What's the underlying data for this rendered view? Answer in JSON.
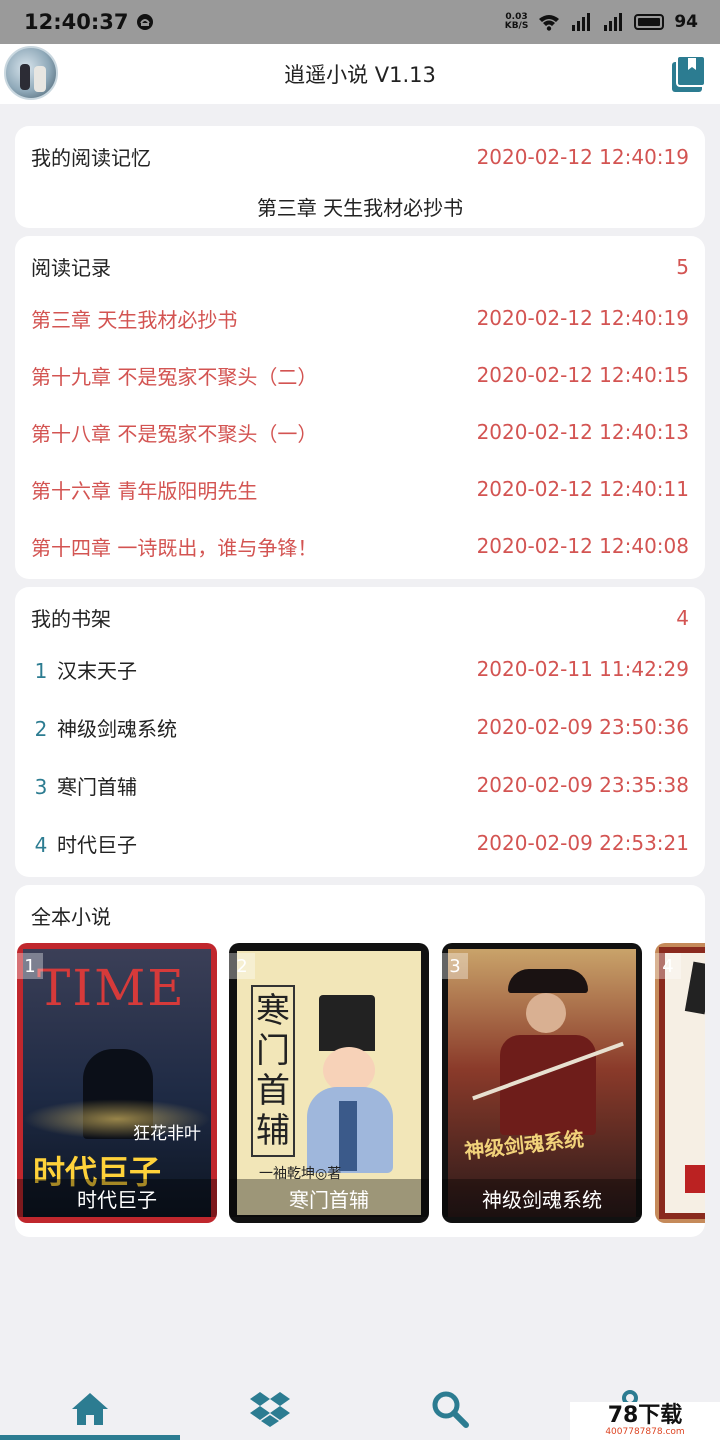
{
  "status_bar": {
    "time": "12:40:37",
    "net_speed_value": "0.03",
    "net_speed_unit": "KB/S",
    "battery": "94"
  },
  "header": {
    "title": "逍遥小说 V1.13"
  },
  "memory_card": {
    "title": "我的阅读记忆",
    "timestamp": "2020-02-12 12:40:19",
    "chapter": "第三章 天生我材必抄书"
  },
  "history_card": {
    "title": "阅读记录",
    "count": "5",
    "items": [
      {
        "chapter": "第三章 天生我材必抄书",
        "time": "2020-02-12 12:40:19"
      },
      {
        "chapter": "第十九章 不是冤家不聚头（二）",
        "time": "2020-02-12 12:40:15"
      },
      {
        "chapter": "第十八章 不是冤家不聚头（一）",
        "time": "2020-02-12 12:40:13"
      },
      {
        "chapter": "第十六章 青年版阳明先生",
        "time": "2020-02-12 12:40:11"
      },
      {
        "chapter": "第十四章 一诗既出，谁与争锋！",
        "time": "2020-02-12 12:40:08"
      }
    ]
  },
  "shelf_card": {
    "title": "我的书架",
    "count": "4",
    "items": [
      {
        "index": "1",
        "name": "汉末天子",
        "time": "2020-02-11 11:42:29"
      },
      {
        "index": "2",
        "name": "神级剑魂系统",
        "time": "2020-02-09 23:50:36"
      },
      {
        "index": "3",
        "name": "寒门首辅",
        "time": "2020-02-09 23:35:38"
      },
      {
        "index": "4",
        "name": "时代巨子",
        "time": "2020-02-09 22:53:21"
      }
    ]
  },
  "novels_card": {
    "title": "全本小说",
    "covers": [
      {
        "index": "1",
        "name": "时代巨子",
        "art_text": "TIME",
        "subtitle": "狂花非叶"
      },
      {
        "index": "2",
        "name": "寒门首辅",
        "art_text": "寒门首辅",
        "subtitle": "一袖乾坤◎著"
      },
      {
        "index": "3",
        "name": "神级剑魂系统",
        "art_text": "神级剑魂系统"
      },
      {
        "index": "4",
        "name": "",
        "art_text": ""
      }
    ]
  },
  "bottom_nav": {
    "items": [
      "home-icon",
      "dropbox-icon",
      "search-icon",
      "location-icon"
    ]
  },
  "watermark": {
    "main": "78下载",
    "sub": "4007787878.com"
  },
  "colors": {
    "accent": "#2c7c91",
    "time_red": "#d35452",
    "background": "#f0f0f3"
  }
}
